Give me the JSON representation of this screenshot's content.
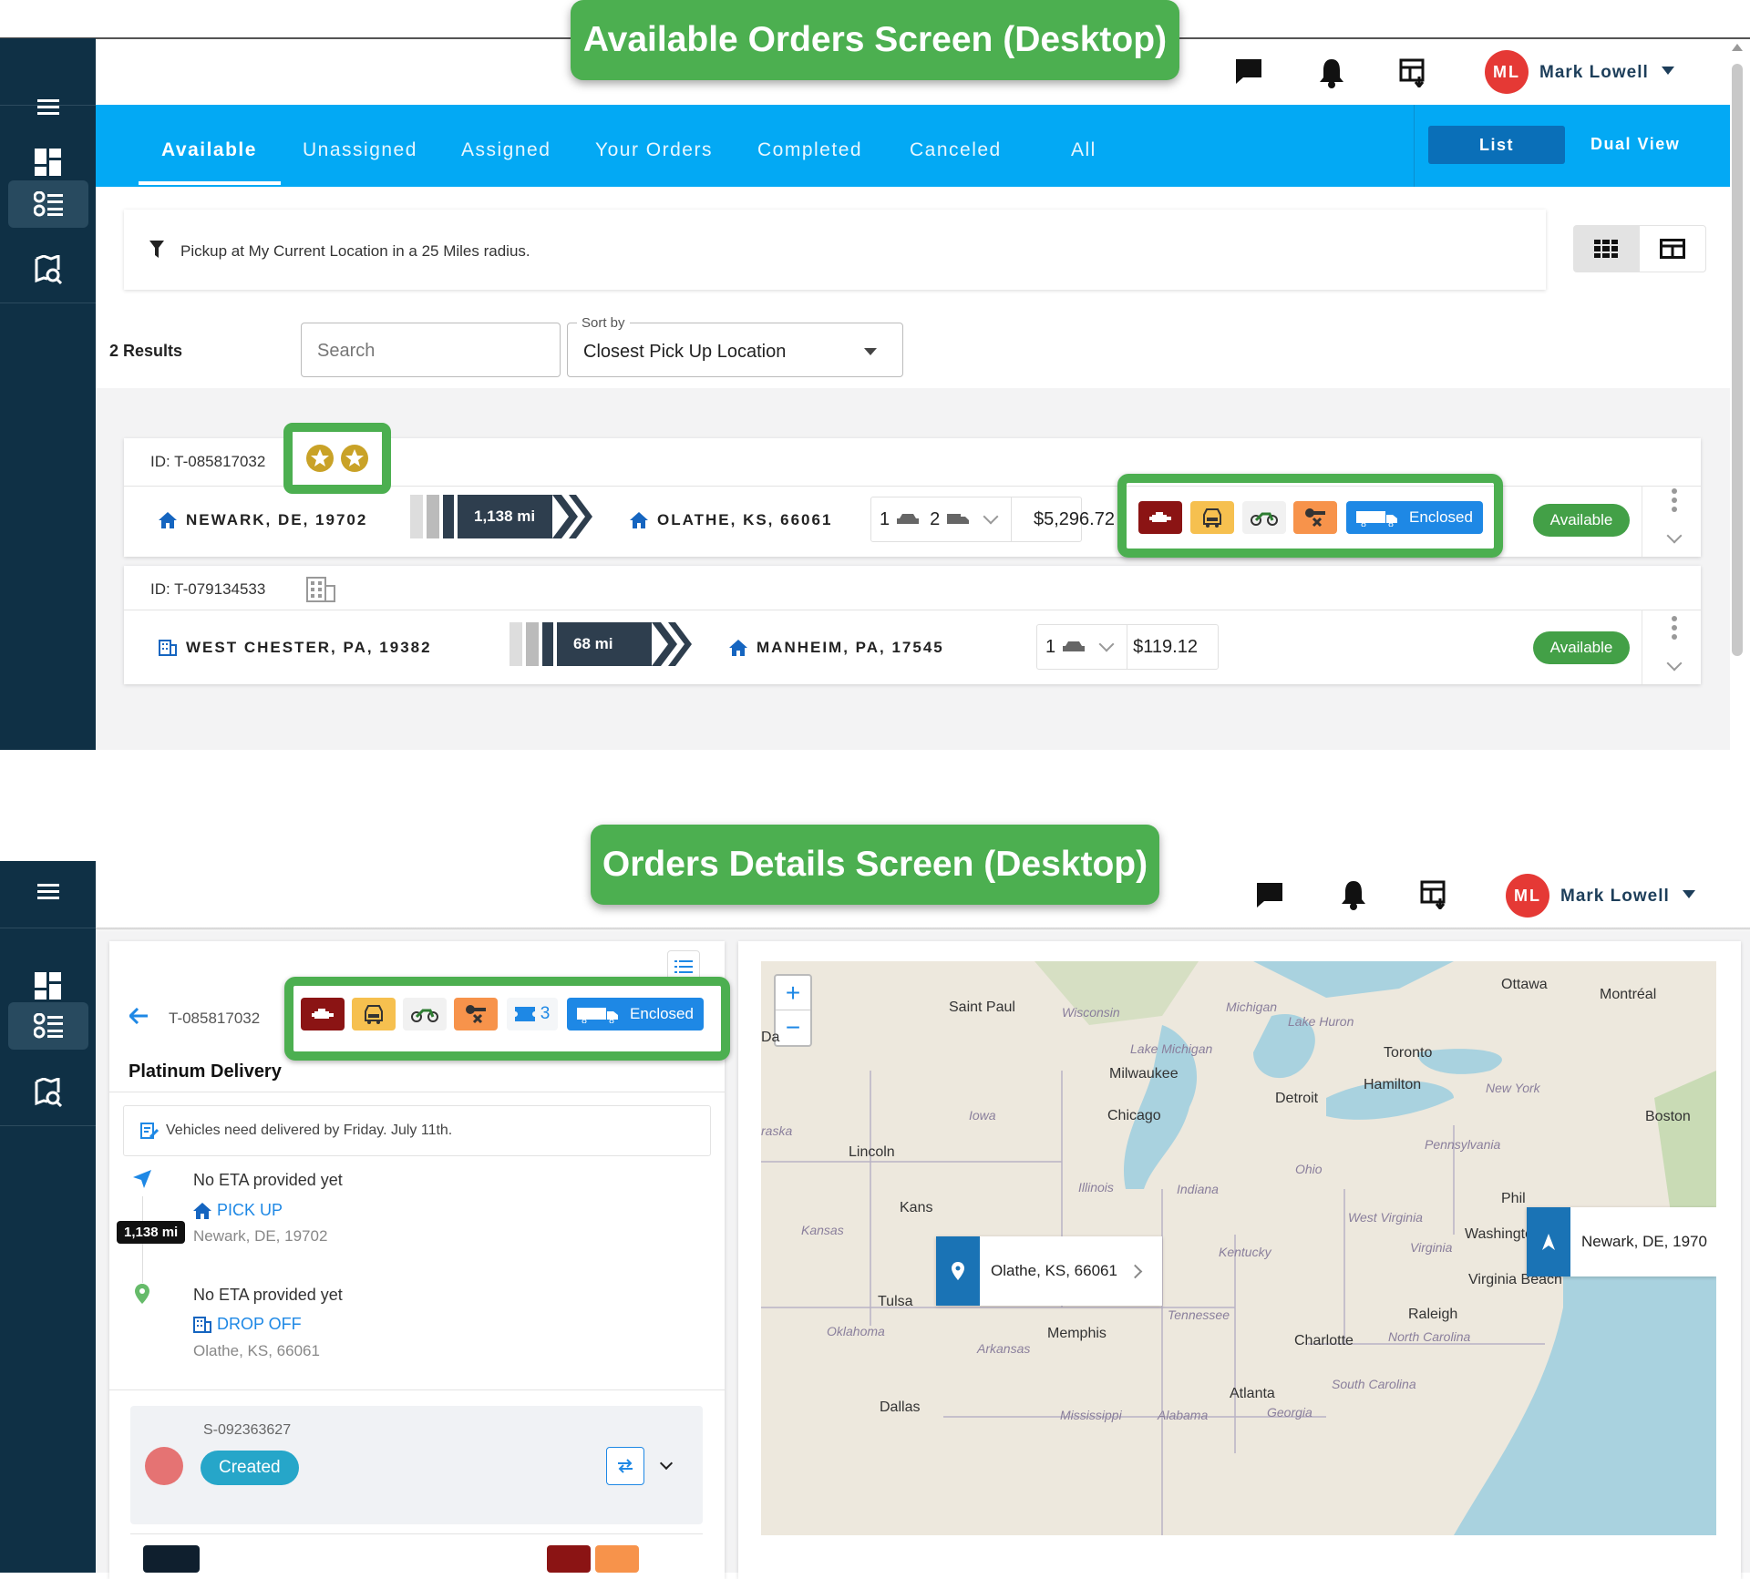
{
  "banners": {
    "top": "Available Orders Screen (Desktop)",
    "bottom": "Orders Details Screen (Desktop)"
  },
  "user": {
    "initials": "ML",
    "name": "Mark Lowell"
  },
  "colors": {
    "sidebar": "#0f3045",
    "tabbar": "#03a9f4",
    "banner": "#4caf50",
    "available": "#43a047",
    "enclosed": "#1e88e5"
  },
  "tabs": [
    "Available",
    "Unassigned",
    "Assigned",
    "Your Orders",
    "Completed",
    "Canceled",
    "All"
  ],
  "view_toggle": {
    "list": "List",
    "dual": "Dual View"
  },
  "filter_text": "Pickup at My Current Location in a 25 Miles radius.",
  "results": "2 Results",
  "search_placeholder": "Search",
  "sort": {
    "label": "Sort by",
    "value": "Closest Pick Up Location"
  },
  "orders": [
    {
      "id": "ID: T-085817032",
      "from": "NEWARK, DE, 19702",
      "distance": "1,138 mi",
      "to": "OLATHE, KS, 66061",
      "cars": "1",
      "trucks": "2",
      "price": "$5,296.72",
      "enclosed": "Enclosed",
      "status": "Available"
    },
    {
      "id": "ID: T-079134533",
      "from": "WEST CHESTER, PA, 19382",
      "distance": "68 mi",
      "to": "MANHEIM, PA, 17545",
      "cars": "1",
      "price": "$119.12",
      "status": "Available"
    }
  ],
  "details": {
    "order_id": "T-085817032",
    "service": "Platinum Delivery",
    "count": "3",
    "enclosed": "Enclosed",
    "note": "Vehicles need delivered by Friday. July 11th.",
    "eta1": "No ETA provided yet",
    "pickup_label": "PICK UP",
    "pickup_addr": "Newark, DE, 19702",
    "distance": "1,138 mi",
    "eta2": "No ETA provided yet",
    "dropoff_label": "DROP OFF",
    "dropoff_addr": "Olathe, KS, 66061",
    "shipment_id": "S-092363627",
    "shipment_status": "Created"
  },
  "map": {
    "zoom_in": "+",
    "zoom_out": "−",
    "popup_dest": "Olathe, KS, 66061",
    "popup_origin": "Newark, DE, 1970",
    "cities": [
      "Saint Paul",
      "Ottawa",
      "Montréal",
      "Milwaukee",
      "Toronto",
      "Hamilton",
      "Detroit",
      "Chicago",
      "Boston",
      "Lincoln",
      "Kans",
      "Phil",
      "Washington",
      "Virginia Beach",
      "Tulsa",
      "Memphis",
      "Raleigh",
      "Charlotte",
      "Atlanta",
      "Dallas",
      "Da",
      "raska"
    ],
    "states": [
      "Wisconsin",
      "Michigan",
      "Lake Huron",
      "Lake Michigan",
      "New York",
      "Iowa",
      "Pennsylvania",
      "Ohio",
      "Illinois",
      "Indiana",
      "West Virginia",
      "Virginia",
      "Kansas",
      "Kentucky",
      "Tennessee",
      "North Carolina",
      "Oklahoma",
      "Arkansas",
      "South Carolina",
      "Mississippi",
      "Alabama",
      "Georgia"
    ]
  }
}
